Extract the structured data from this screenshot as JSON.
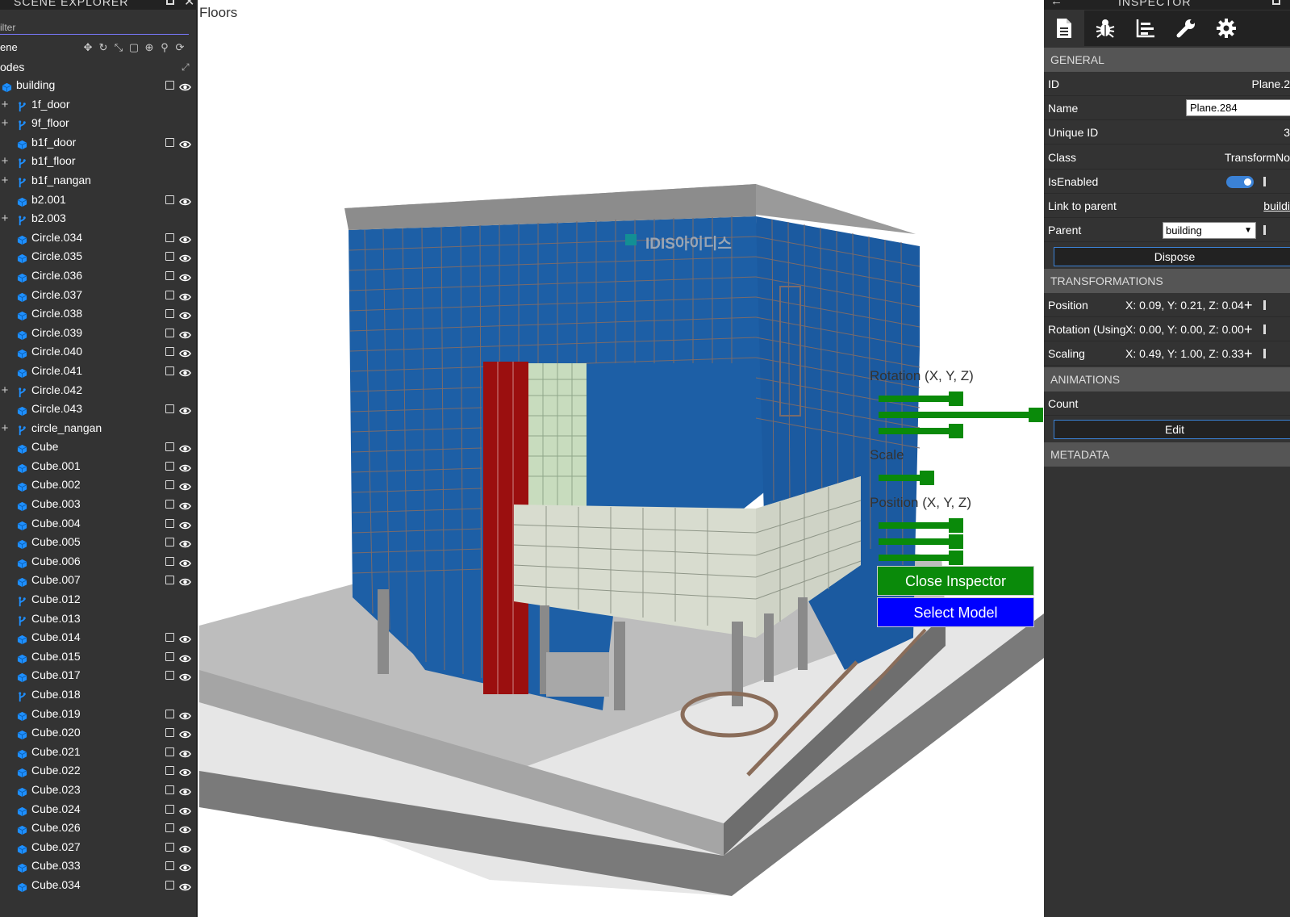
{
  "explorer": {
    "title": "SCENE EXPLORER",
    "filter_placeholder": "Filter",
    "filter_visible": "ilter",
    "scene_label": "ene",
    "nodes_label": "odes",
    "nodes": [
      {
        "name": "building",
        "icon": "mesh",
        "expand": "",
        "root": true,
        "box": true,
        "eye": true
      },
      {
        "name": "1f_door",
        "icon": "transform",
        "expand": "+",
        "box": false,
        "eye": false
      },
      {
        "name": "9f_floor",
        "icon": "transform",
        "expand": "+",
        "box": false,
        "eye": false
      },
      {
        "name": "b1f_door",
        "icon": "mesh",
        "expand": "",
        "box": true,
        "eye": true
      },
      {
        "name": "b1f_floor",
        "icon": "transform",
        "expand": "+",
        "box": false,
        "eye": false
      },
      {
        "name": "b1f_nangan",
        "icon": "transform",
        "expand": "+",
        "box": false,
        "eye": false
      },
      {
        "name": "b2.001",
        "icon": "mesh",
        "expand": "",
        "box": true,
        "eye": true
      },
      {
        "name": "b2.003",
        "icon": "transform",
        "expand": "+",
        "box": false,
        "eye": false
      },
      {
        "name": "Circle.034",
        "icon": "mesh",
        "expand": "",
        "box": true,
        "eye": true
      },
      {
        "name": "Circle.035",
        "icon": "mesh",
        "expand": "",
        "box": true,
        "eye": true
      },
      {
        "name": "Circle.036",
        "icon": "mesh",
        "expand": "",
        "box": true,
        "eye": true
      },
      {
        "name": "Circle.037",
        "icon": "mesh",
        "expand": "",
        "box": true,
        "eye": true
      },
      {
        "name": "Circle.038",
        "icon": "mesh",
        "expand": "",
        "box": true,
        "eye": true
      },
      {
        "name": "Circle.039",
        "icon": "mesh",
        "expand": "",
        "box": true,
        "eye": true
      },
      {
        "name": "Circle.040",
        "icon": "mesh",
        "expand": "",
        "box": true,
        "eye": true
      },
      {
        "name": "Circle.041",
        "icon": "mesh",
        "expand": "",
        "box": true,
        "eye": true
      },
      {
        "name": "Circle.042",
        "icon": "transform",
        "expand": "+",
        "box": false,
        "eye": false
      },
      {
        "name": "Circle.043",
        "icon": "mesh",
        "expand": "",
        "box": true,
        "eye": true
      },
      {
        "name": "circle_nangan",
        "icon": "transform",
        "expand": "+",
        "box": false,
        "eye": false
      },
      {
        "name": "Cube",
        "icon": "mesh",
        "expand": "",
        "box": true,
        "eye": true
      },
      {
        "name": "Cube.001",
        "icon": "mesh",
        "expand": "",
        "box": true,
        "eye": true
      },
      {
        "name": "Cube.002",
        "icon": "mesh",
        "expand": "",
        "box": true,
        "eye": true
      },
      {
        "name": "Cube.003",
        "icon": "mesh",
        "expand": "",
        "box": true,
        "eye": true
      },
      {
        "name": "Cube.004",
        "icon": "mesh",
        "expand": "",
        "box": true,
        "eye": true
      },
      {
        "name": "Cube.005",
        "icon": "mesh",
        "expand": "",
        "box": true,
        "eye": true
      },
      {
        "name": "Cube.006",
        "icon": "mesh",
        "expand": "",
        "box": true,
        "eye": true
      },
      {
        "name": "Cube.007",
        "icon": "mesh",
        "expand": "",
        "box": true,
        "eye": true
      },
      {
        "name": "Cube.012",
        "icon": "transform",
        "expand": "",
        "box": false,
        "eye": false
      },
      {
        "name": "Cube.013",
        "icon": "transform",
        "expand": "",
        "box": false,
        "eye": false
      },
      {
        "name": "Cube.014",
        "icon": "mesh",
        "expand": "",
        "box": true,
        "eye": true
      },
      {
        "name": "Cube.015",
        "icon": "mesh",
        "expand": "",
        "box": true,
        "eye": true
      },
      {
        "name": "Cube.017",
        "icon": "mesh",
        "expand": "",
        "box": true,
        "eye": true
      },
      {
        "name": "Cube.018",
        "icon": "transform",
        "expand": "",
        "box": false,
        "eye": false
      },
      {
        "name": "Cube.019",
        "icon": "mesh",
        "expand": "",
        "box": true,
        "eye": true
      },
      {
        "name": "Cube.020",
        "icon": "mesh",
        "expand": "",
        "box": true,
        "eye": true
      },
      {
        "name": "Cube.021",
        "icon": "mesh",
        "expand": "",
        "box": true,
        "eye": true
      },
      {
        "name": "Cube.022",
        "icon": "mesh",
        "expand": "",
        "box": true,
        "eye": true
      },
      {
        "name": "Cube.023",
        "icon": "mesh",
        "expand": "",
        "box": true,
        "eye": true
      },
      {
        "name": "Cube.024",
        "icon": "mesh",
        "expand": "",
        "box": true,
        "eye": true
      },
      {
        "name": "Cube.026",
        "icon": "mesh",
        "expand": "",
        "box": true,
        "eye": true
      },
      {
        "name": "Cube.027",
        "icon": "mesh",
        "expand": "",
        "box": true,
        "eye": true
      },
      {
        "name": "Cube.033",
        "icon": "mesh",
        "expand": "",
        "box": true,
        "eye": true
      },
      {
        "name": "Cube.034",
        "icon": "mesh",
        "expand": "",
        "box": true,
        "eye": true
      }
    ]
  },
  "viewport": {
    "floors_label": "Floors",
    "rotation_label": "Rotation (X, Y, Z)",
    "scale_label": "Scale",
    "position_label": "Position (X, Y, Z)",
    "close_inspector_label": "Close Inspector",
    "select_model_label": "Select Model",
    "sign_text": "IDIS아이디스"
  },
  "inspector": {
    "title": "INSPECTOR",
    "tabs": [
      "properties-icon",
      "debug-icon",
      "statistics-icon",
      "tools-icon",
      "settings-icon"
    ],
    "general": {
      "header": "GENERAL",
      "id_label": "ID",
      "id_value": "Plane.2",
      "name_label": "Name",
      "name_value": "Plane.284",
      "uid_label": "Unique ID",
      "uid_value": "3",
      "class_label": "Class",
      "class_value": "TransformNo",
      "enabled_label": "IsEnabled",
      "link_label": "Link to parent",
      "link_value": "buildi",
      "parent_label": "Parent",
      "parent_value": "building",
      "dispose_label": "Dispose"
    },
    "transformations": {
      "header": "TRANSFORMATIONS",
      "position_label": "Position",
      "position_value": "X: 0.09, Y: 0.21, Z: 0.04",
      "rotation_label": "Rotation (Using",
      "rotation_value": "X: 0.00, Y: 0.00, Z: 0.00",
      "scaling_label": "Scaling",
      "scaling_value": "X: 0.49, Y: 1.00, Z: 0.33"
    },
    "animations": {
      "header": "ANIMATIONS",
      "count_label": "Count",
      "edit_label": "Edit"
    },
    "metadata": {
      "header": "METADATA"
    }
  },
  "colors": {
    "panel_bg": "#333333",
    "accent": "#3b82d6",
    "gui_green": "#0a8a0a",
    "select_blue": "#0000ff",
    "facade_blue": "#1d5fa6",
    "facade_red": "#9b0f0f"
  }
}
